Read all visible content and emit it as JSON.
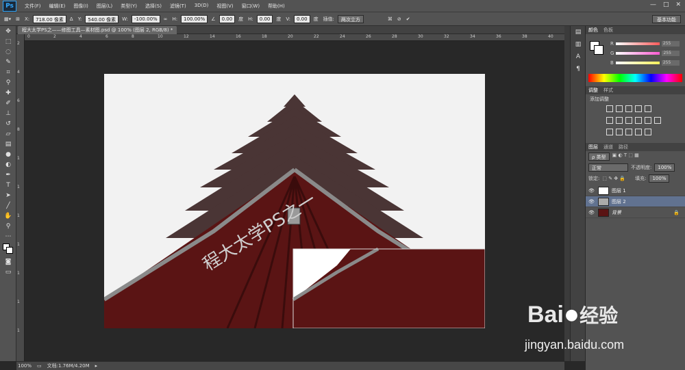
{
  "app": {
    "logo": "Ps"
  },
  "menu": [
    "文件(F)",
    "编辑(E)",
    "图像(I)",
    "图层(L)",
    "类型(Y)",
    "选择(S)",
    "滤镜(T)",
    "3D(D)",
    "视图(V)",
    "窗口(W)",
    "帮助(H)"
  ],
  "window_controls": [
    "—",
    "□",
    "✕"
  ],
  "options": {
    "x_label": "X:",
    "x_value": "718.00 像素",
    "y_label": "Y:",
    "y_value": "540.00 像素",
    "w_label": "W:",
    "w_value": "-100.00%",
    "h_label": "H:",
    "h_value": "100.00%",
    "angle_value": "0.00",
    "degree_unit": "度",
    "hskew_label": "H:",
    "hskew_value": "0.00",
    "vskew_label": "V:",
    "vskew_value": "0.00",
    "interp_label": "插值:",
    "interp_value": "两次立方",
    "workspace": "基本功能"
  },
  "document": {
    "tab_title": "程大太学PS之——修图工具—素材图.psd @ 100% (图层 2, RGB/8) *"
  },
  "ruler": {
    "h_ticks": [
      "0",
      "2",
      "4",
      "6",
      "8",
      "10",
      "12",
      "14",
      "16",
      "18",
      "20",
      "22",
      "24",
      "26",
      "28",
      "30",
      "32",
      "34",
      "36",
      "38",
      "40"
    ],
    "v_ticks": [
      "2",
      "4",
      "6",
      "8",
      "1",
      "1",
      "1",
      "1",
      "1",
      "1",
      "1"
    ]
  },
  "status": {
    "zoom": "100%",
    "doc_label": "文档:1.76M/4.20M"
  },
  "watermark_text": "程大太学PS之一",
  "panels": {
    "color_tabs": [
      "颜色",
      "色板"
    ],
    "sliders": [
      {
        "label": "R",
        "value": "255",
        "color": "#ff5a5a"
      },
      {
        "label": "G",
        "value": "255",
        "color": "#ff5ad2"
      },
      {
        "label": "B",
        "value": "255",
        "color": "#f5f05a"
      }
    ],
    "adj_tabs": [
      "调整",
      "样式"
    ],
    "adj_title": "添加调整",
    "layer_tabs": [
      "图层",
      "通道",
      "路径"
    ],
    "kind_label": "ρ 类型",
    "blend_mode": "正常",
    "opacity_label": "不透明度:",
    "opacity_value": "100%",
    "lock_label": "锁定:",
    "fill_label": "填充:",
    "fill_value": "100%",
    "layers": [
      {
        "name": "图层 1"
      },
      {
        "name": "图层 2"
      },
      {
        "name": "背景"
      }
    ]
  },
  "baidu": {
    "logo_text": "Bai",
    "logo_text2": "经验",
    "url": "jingyan.baidu.com"
  },
  "colors": {
    "accent_selected_layer": "#617290",
    "canvas_bg": "#282828",
    "roof_red": "#5a1414"
  }
}
